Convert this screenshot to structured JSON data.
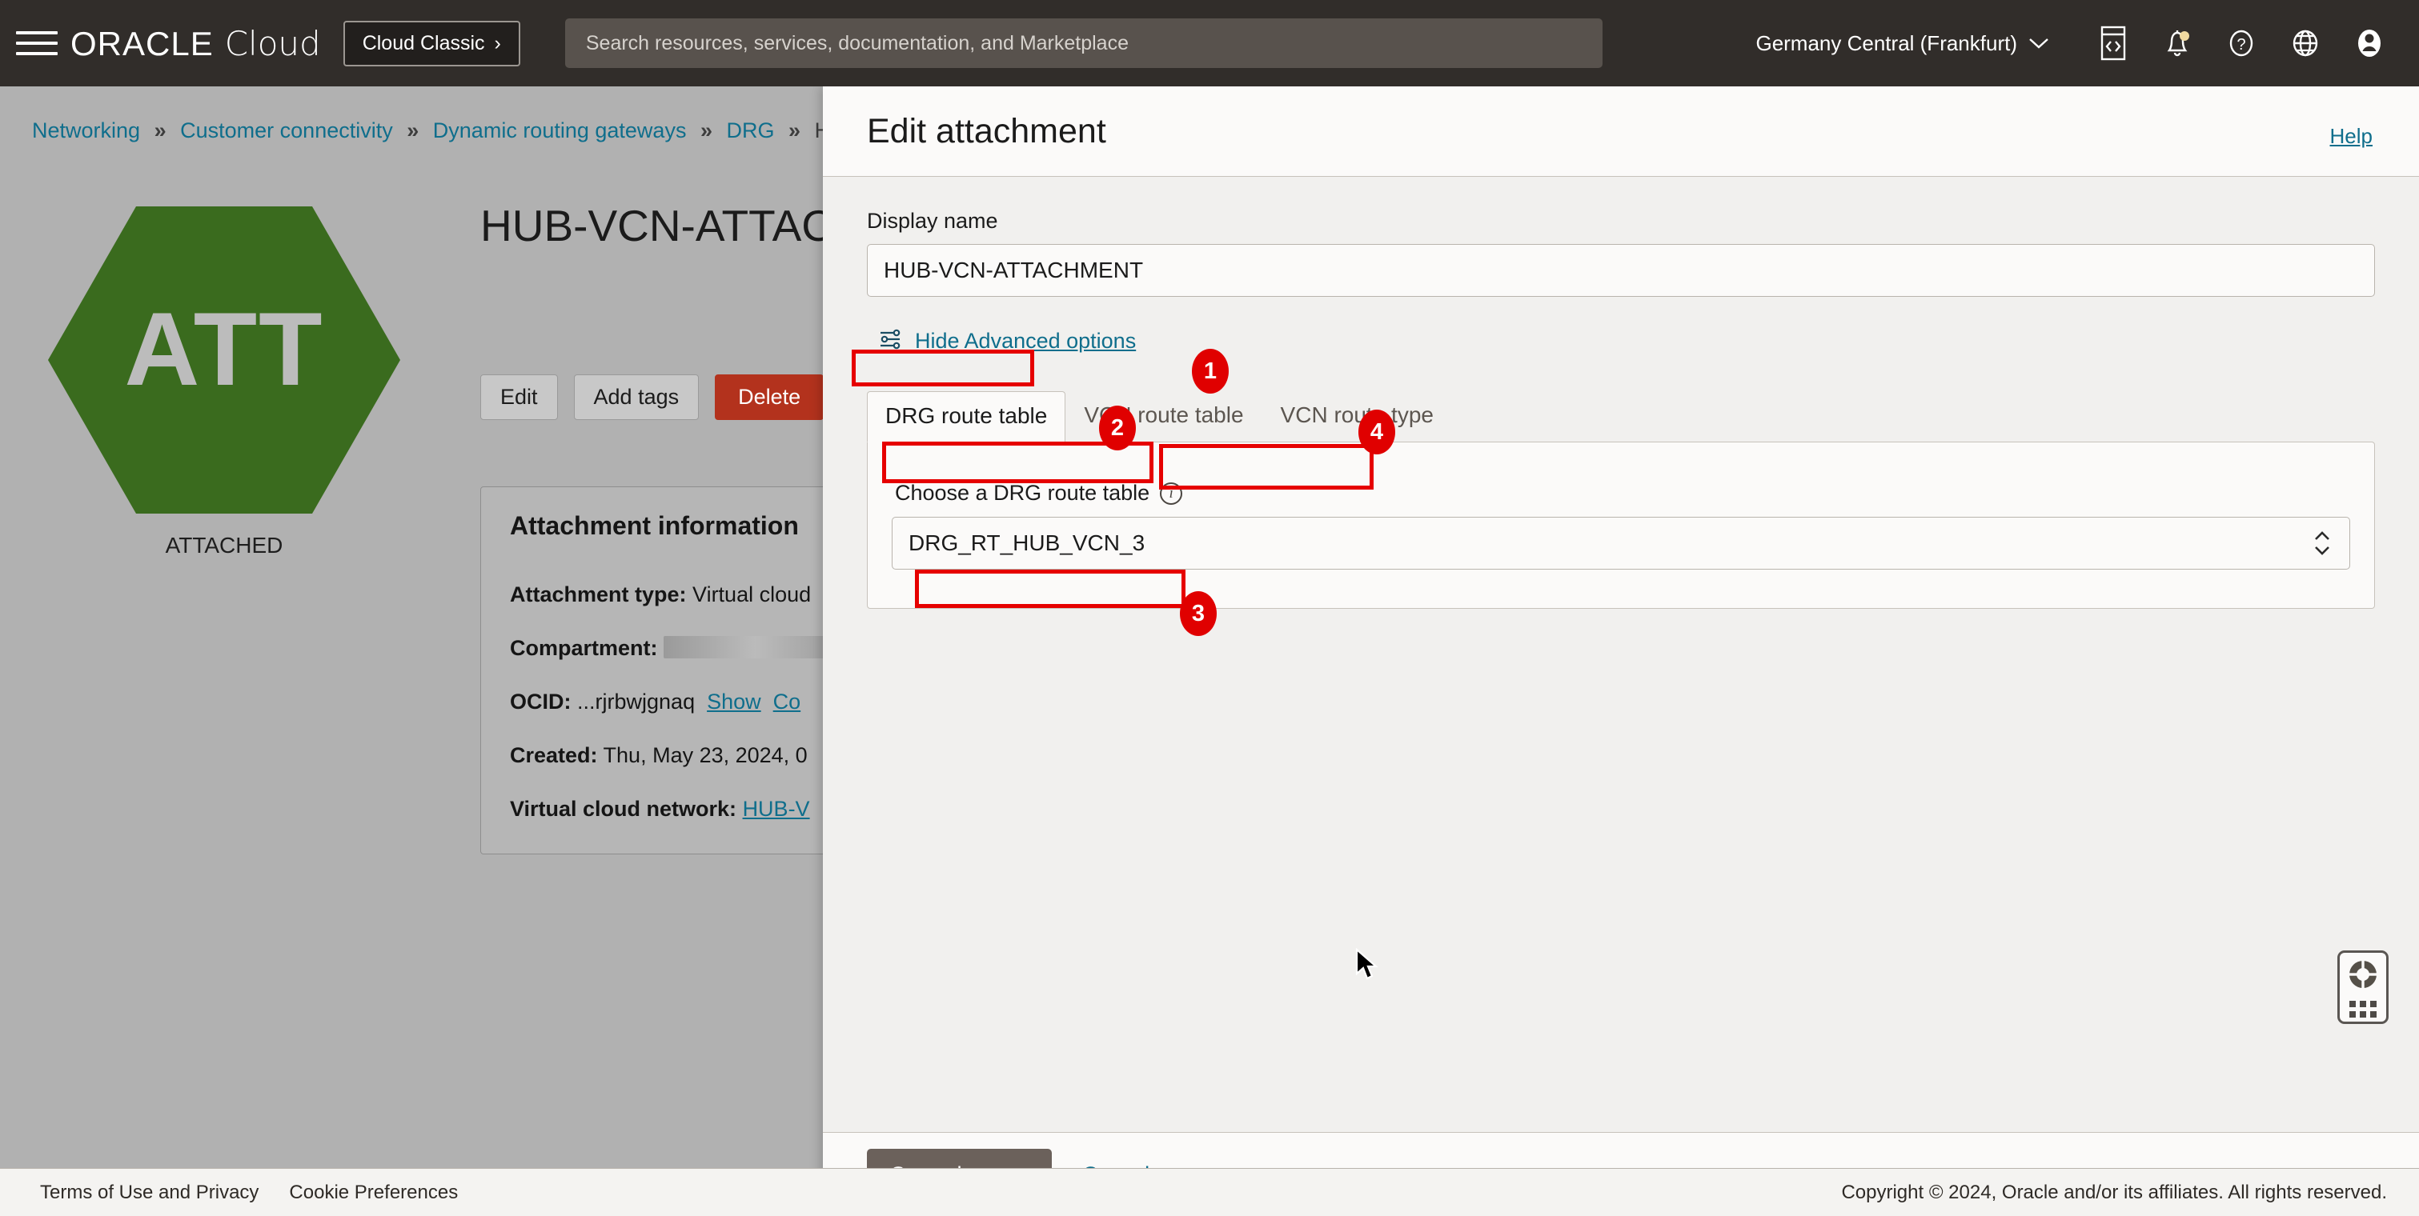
{
  "topbar": {
    "menu_icon": "hamburger-icon",
    "brand": {
      "oracle": "ORACLE",
      "cloud": "Cloud"
    },
    "cloud_classic_label": "Cloud Classic",
    "cloud_classic_chevron": "›",
    "search_placeholder": "Search resources, services, documentation, and Marketplace",
    "region": "Germany Central (Frankfurt)",
    "region_chevron": "⌄",
    "icons": [
      "code-editor-icon",
      "notifications-bell-icon",
      "help-question-icon",
      "language-globe-icon",
      "user-avatar-icon"
    ],
    "bg_color": "#312d2a"
  },
  "background_page": {
    "breadcrumb": [
      {
        "label": "Networking",
        "link": true
      },
      {
        "label": "Customer connectivity",
        "link": true
      },
      {
        "label": "Dynamic routing gateways",
        "link": true
      },
      {
        "label": "DRG",
        "link": true
      },
      {
        "label": "HUB",
        "link": false
      }
    ],
    "breadcrumb_separator": "»",
    "hex_badge": "ATT",
    "hex_color": "#3a6b1e",
    "status_caption": "ATTACHED",
    "page_title": "HUB-VCN-ATTAC",
    "buttons": {
      "edit": "Edit",
      "add_tags": "Add tags",
      "delete": "Delete",
      "delete_color": "#b3321d"
    },
    "info_card": {
      "heading": "Attachment information",
      "rows": [
        {
          "label": "Attachment type:",
          "value": "Virtual cloud"
        },
        {
          "label": "Compartment:",
          "value": ""
        },
        {
          "label": "OCID:",
          "value": "...rjrbwjgnaq",
          "links": [
            "Show",
            "Co"
          ]
        },
        {
          "label": "Created:",
          "value": "Thu, May 23, 2024, 0"
        },
        {
          "label": "Virtual cloud network:",
          "value": "HUB-V",
          "value_is_link": true
        }
      ]
    }
  },
  "panel": {
    "title": "Edit attachment",
    "help_link": "Help",
    "display_name": {
      "label": "Display name",
      "value": "HUB-VCN-ATTACHMENT",
      "placeholder": ""
    },
    "advanced": {
      "icon": "sliders-icon",
      "link": "Hide Advanced options"
    },
    "tabs": [
      {
        "label": "DRG route table",
        "active": true
      },
      {
        "label": "VCN route table",
        "active": false
      },
      {
        "label": "VCN route type",
        "active": false
      }
    ],
    "drg_route_table": {
      "label": "Choose a DRG route table",
      "info_icon": "info-icon",
      "selected": "DRG_RT_HUB_VCN_3",
      "spinner_icon": "spinner-updown-icon"
    },
    "footer": {
      "save": "Save changes",
      "cancel": "Cancel",
      "save_color": "#6b615b"
    }
  },
  "annotations": {
    "accent_color": "#e00000",
    "steps": [
      {
        "number": "1",
        "target": "Hide Advanced options"
      },
      {
        "number": "2",
        "target": "DRG route table tab"
      },
      {
        "number": "3",
        "target": "DRG_RT_HUB_VCN_3 select"
      },
      {
        "number": "4",
        "target": "VCN route table tab"
      }
    ]
  },
  "support_widget": {
    "icon": "lifebuoy-icon",
    "handle": "drag-dots-icon"
  },
  "footer": {
    "terms": "Terms of Use and Privacy",
    "cookies": "Cookie Preferences",
    "copyright": "Copyright © 2024, Oracle and/or its affiliates. All rights reserved."
  }
}
